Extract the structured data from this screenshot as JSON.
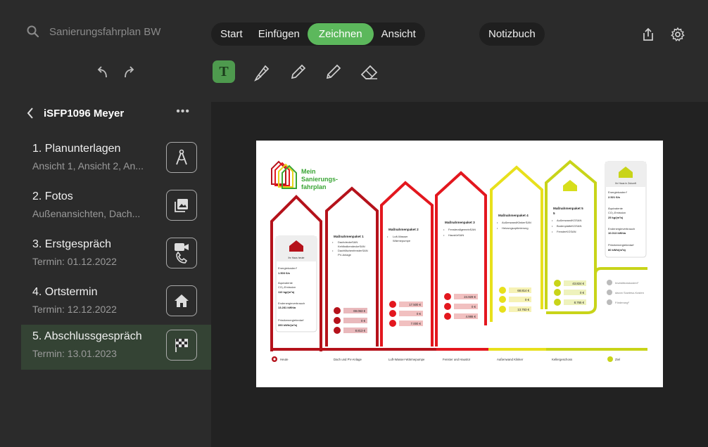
{
  "search": {
    "placeholder": "Sanierungsfahrplan BW"
  },
  "tabs": [
    "Start",
    "Einfügen",
    "Zeichnen",
    "Ansicht"
  ],
  "notebook_label": "Notizbuch",
  "accent_color": "#5cb85c",
  "sidebar": {
    "title": "iSFP1096 Meyer",
    "items": [
      {
        "label": "1.  Planunterlagen",
        "sub": "Ansicht 1, Ansicht 2, An...",
        "icon": "compass-icon"
      },
      {
        "label": "2. Fotos",
        "sub": "Außenansichten, Dach...",
        "icon": "photos-icon"
      },
      {
        "label": "3. Erstgespräch",
        "sub": "Termin: 01.12.2022",
        "icon": "video-call-icon"
      },
      {
        "label": "4. Ortstermin",
        "sub": "Termin: 12.12.2022",
        "icon": "house-icon"
      },
      {
        "label": "5. Abschlussgespräch",
        "sub": "Termin: 13.01.2023",
        "icon": "finish-flag-icon"
      }
    ]
  },
  "doc": {
    "logo": [
      "Mein",
      "Sanierungs-",
      "fahrplan"
    ],
    "today": {
      "title": "Ihr Haus heute",
      "energy_label": "Energiekosten¹",
      "energy": "1.503 €/a",
      "co2_label1": "Äquivalente",
      "co2_label2": "CO₂-Emission",
      "co2": "110 kg/(m²a)",
      "end_label": "Endenergieverbrauch",
      "end": "13.281 kWh/a",
      "prim_label": "Primärenergiebedarf",
      "prim": "390 kWh/(m²a)"
    },
    "future": {
      "title": "Ihr Haus in Zukunft",
      "energy_label": "Energiekosten¹",
      "energy": "2.521 €/a",
      "co2_label1": "Äquivalente",
      "co2_label2": "CO₂-Emission",
      "co2": "25 kg/(m²a)",
      "end_label": "Endenergieverbrauch",
      "end": "10.013 kWh/a",
      "prim_label": "Primärenergiebedarf",
      "prim": "80 kWh/(m²a)"
    },
    "packages": [
      {
        "title": "Maßnahmenpaket 1",
        "items": [
          "DachdeckeSAN",
          "KehlbalkendeckeSAN",
          "DachflächenfensterSAN",
          "PV-Anlage"
        ],
        "values": [
          "69.063 €",
          "0 €",
          "8.813 €"
        ],
        "label": "Dach und PV-Anlage"
      },
      {
        "title": "Maßnahmenpaket 2",
        "items": [
          "Luft-Wasser",
          "Wärmepumpe"
        ],
        "values": [
          "17.500 €",
          "0 €",
          "7.000 €"
        ],
        "label": "Luft-Wasser-Wärmepumpe"
      },
      {
        "title": "Maßnahmenpaket 3",
        "items": [
          "FensterallgemeinSAN",
          "HaustürSAN"
        ],
        "values": [
          "24.929 €",
          "0 €",
          "4.986 €"
        ],
        "label": "Fenster und Haustür"
      },
      {
        "title": "Maßnahmenpaket 4",
        "items": [
          "AußenwandKlinkerSAN",
          "Heizungsoptimierung"
        ],
        "values": [
          "68.814 €",
          "0 €",
          "13.763 €"
        ],
        "label": "Außenwand Klinker"
      },
      {
        "title": "Maßnahmenpaket 5",
        "items": [
          "AußenwandKGSAN",
          "BodenplatteKGSAN",
          "FensterKGSAN"
        ],
        "values": [
          "43.824 €",
          "0 €",
          "8.765 €"
        ],
        "label": "Kellergeschoss"
      }
    ],
    "legend": [
      "Investitionskosten¹",
      "davon Sowieso-Kosten",
      "Förderung²"
    ],
    "today_label": "Heute",
    "goal_label": "Ziel"
  }
}
